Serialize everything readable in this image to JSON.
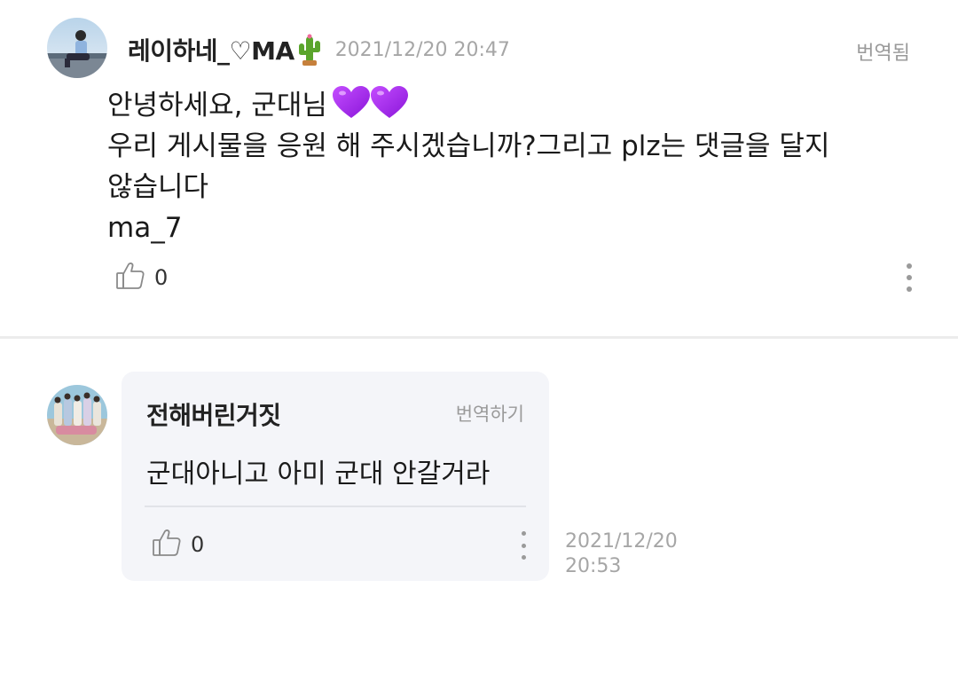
{
  "post": {
    "author": "레이하네_♡MA",
    "timestamp": "2021/12/20 20:47",
    "translated_label": "번역됨",
    "body_lines": [
      "안녕하세요, 군대님",
      "우리 게시물을 응원 해 주시겠습니까?그리고 plz는 댓글을 달지",
      "않습니다",
      "ma_7"
    ],
    "like_count": "0",
    "icons": [
      "avatar",
      "cactus-emoji",
      "purple-heart-emoji",
      "thumbs-up-icon",
      "more-vertical-icon"
    ]
  },
  "comment": {
    "author": "전해버린거짓",
    "translate_label": "번역하기",
    "text": "군대아니고 아미 군대 안갈거라",
    "like_count": "0",
    "timestamp_date": "2021/12/20",
    "timestamp_time": "20:53"
  },
  "colors": {
    "card_background": "#f4f5f9",
    "muted_text": "#a6a6a6",
    "divider": "#ececec",
    "heart": "#a020f0"
  }
}
